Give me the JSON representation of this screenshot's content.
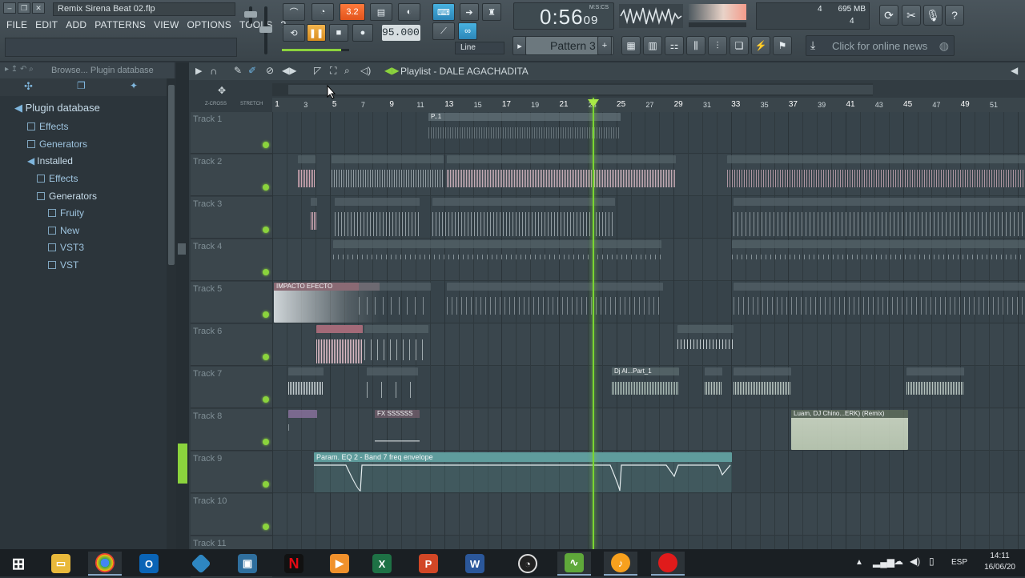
{
  "window": {
    "title": "Remix Sirena Beat 02.flp"
  },
  "menu": [
    "FILE",
    "EDIT",
    "ADD",
    "PATTERNS",
    "VIEW",
    "OPTIONS",
    "TOOLS",
    "?"
  ],
  "transport": {
    "song_pattern": "3.2",
    "tempo": "95.000",
    "time": "0:56",
    "time_frac": "09",
    "time_unit": "M:S:CS",
    "snap": "Line",
    "pattern": "Pattern 3"
  },
  "monitor": {
    "memory": "695 MB",
    "voices": "4",
    "cpu": "4"
  },
  "news": {
    "text": "Click for online news"
  },
  "browser": {
    "header": "Browse... Plugin database",
    "items": [
      {
        "label": "Plugin database",
        "level": 0,
        "root": true
      },
      {
        "label": "Effects",
        "level": 1
      },
      {
        "label": "Generators",
        "level": 1
      },
      {
        "label": "Installed",
        "level": 1
      },
      {
        "label": "Effects",
        "level": 2
      },
      {
        "label": "Generators",
        "level": 2
      },
      {
        "label": "Fruity",
        "level": 3
      },
      {
        "label": "New",
        "level": 3
      },
      {
        "label": "VST3",
        "level": 3
      },
      {
        "label": "VST",
        "level": 3
      }
    ]
  },
  "playlist": {
    "title": "Playlist - DALE AGACHADITA",
    "ruler_labels": [
      "Z-CROSS",
      "STRETCH"
    ],
    "bars": [
      "1",
      "3",
      "5",
      "7",
      "9",
      "11",
      "13",
      "15",
      "17",
      "19",
      "21",
      "23",
      "25",
      "27",
      "29",
      "31",
      "33",
      "35",
      "37",
      "39",
      "41",
      "43",
      "45",
      "47",
      "49",
      "51"
    ],
    "tracks": [
      "Track 1",
      "Track 2",
      "Track 3",
      "Track 4",
      "Track 5",
      "Track 6",
      "Track 7",
      "Track 8",
      "Track 9",
      "Track 10",
      "Track 11"
    ],
    "clip_labels": {
      "impacto": "IMPACTO EFECTO",
      "fx": "FX SSSSSS",
      "dj": "Dj Al...Part_1",
      "luam": "Luam, DJ Chino...ERK) (Remix)",
      "eq": "Param. EQ 2 - Band 7 freq envelope",
      "p1": "P..1"
    }
  },
  "taskbar": {
    "lang": "ESP",
    "time": "14:11",
    "date": "16/06/20"
  },
  "colors": {
    "accent_orange": "#e2541c",
    "accent_blue": "#2c86b8",
    "playhead": "#7ad531",
    "clip_pink": "#c99aa5",
    "clip_teal": "#5f9c9c"
  }
}
